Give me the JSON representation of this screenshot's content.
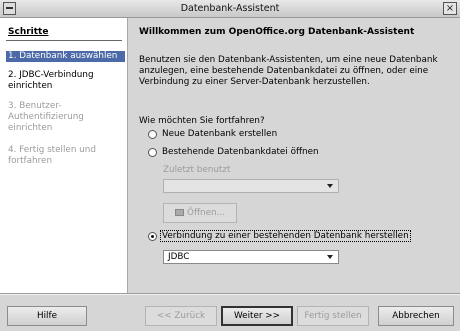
{
  "window": {
    "title": "Datenbank-Assistent"
  },
  "steps": {
    "title": "Schritte",
    "items": [
      {
        "label": "1. Datenbank auswählen",
        "state": "active"
      },
      {
        "label": "2. JDBC-Verbindung einrichten",
        "state": "enabled"
      },
      {
        "label": "3. Benutzer-Authentifizierung einrichten",
        "state": "disabled"
      },
      {
        "label": "4. Fertig stellen und fortfahren",
        "state": "disabled"
      }
    ]
  },
  "main": {
    "heading": "Willkommen zum OpenOffice.org Datenbank-Assistent",
    "intro": "Benutzen sie den Datenbank-Assistenten, um eine neue Datenbank anzulegen, eine bestehende Datenbankdatei zu öffnen, oder eine Verbindung zu einer Server-Datenbank herzustellen.",
    "question": "Wie möchten Sie fortfahren?",
    "options": [
      {
        "label": "Neue Datenbank erstellen",
        "checked": false
      },
      {
        "label": "Bestehende Datenbankdatei öffnen",
        "checked": false
      },
      {
        "label": "Verbindung zu einer bestehenden Datenbank herstellen",
        "checked": true
      }
    ],
    "recent_label": "Zuletzt benutzt",
    "recent_value": "",
    "open_button": "Öffnen...",
    "driver_value": "JDBC"
  },
  "footer": {
    "help": "Hilfe",
    "back": "<< Zurück",
    "next": "Weiter >>",
    "finish": "Fertig stellen",
    "cancel": "Abbrechen"
  }
}
